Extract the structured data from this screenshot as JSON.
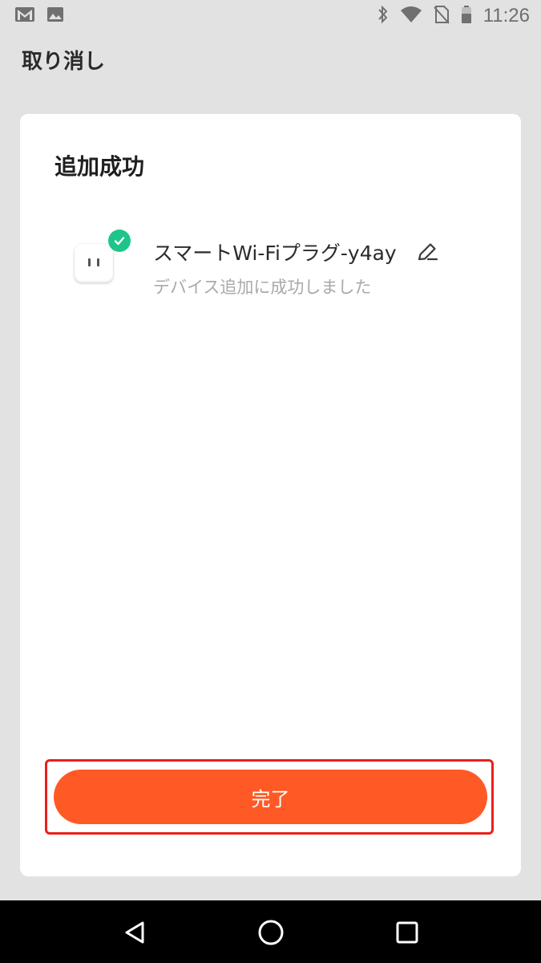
{
  "status_bar": {
    "time": "11:26",
    "left_icons": [
      "gmail-icon",
      "image-icon"
    ],
    "right_icons": [
      "bluetooth-icon",
      "wifi-icon",
      "no-sim-icon",
      "battery-icon"
    ]
  },
  "header": {
    "cancel_label": "取り消し"
  },
  "card": {
    "title": "追加成功",
    "device": {
      "name": "スマートWi-Fiプラグ-y4ay",
      "status": "デバイス追加に成功しました",
      "icon": "smart-plug-icon",
      "badge_icon": "check-icon",
      "badge_color": "#1ec58a"
    },
    "done_label": "完了"
  },
  "colors": {
    "accent": "#ff5a26",
    "highlight": "#e8201b",
    "background": "#e2e2e2"
  },
  "nav_bar": {
    "buttons": [
      "back-icon",
      "home-icon",
      "recents-icon"
    ]
  }
}
